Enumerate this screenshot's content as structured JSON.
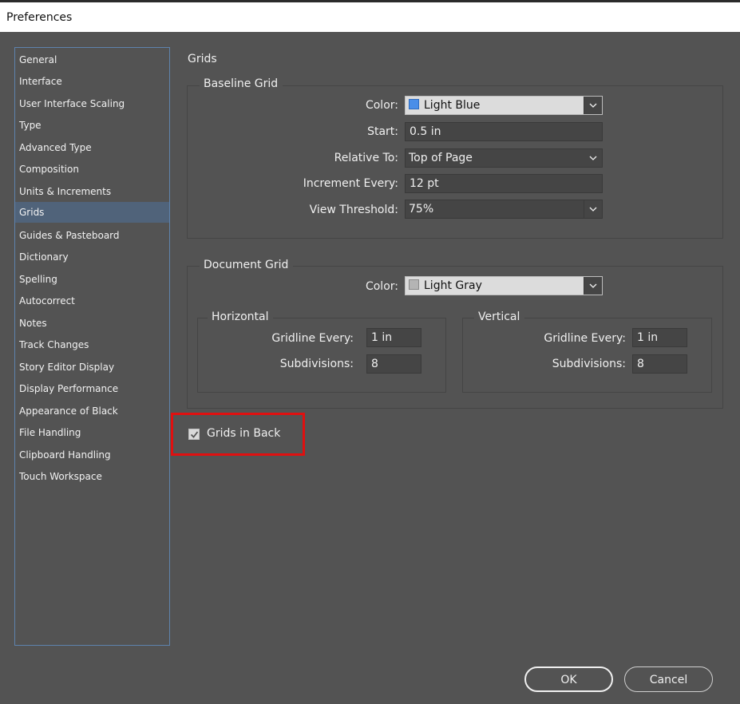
{
  "window": {
    "title": "Preferences"
  },
  "sidebar": {
    "items": [
      {
        "label": "General"
      },
      {
        "label": "Interface"
      },
      {
        "label": "User Interface Scaling"
      },
      {
        "label": "Type"
      },
      {
        "label": "Advanced Type"
      },
      {
        "label": "Composition"
      },
      {
        "label": "Units & Increments"
      },
      {
        "label": "Grids",
        "selected": true
      },
      {
        "label": "Guides & Pasteboard"
      },
      {
        "label": "Dictionary"
      },
      {
        "label": "Spelling"
      },
      {
        "label": "Autocorrect"
      },
      {
        "label": "Notes"
      },
      {
        "label": "Track Changes"
      },
      {
        "label": "Story Editor Display"
      },
      {
        "label": "Display Performance"
      },
      {
        "label": "Appearance of Black"
      },
      {
        "label": "File Handling"
      },
      {
        "label": "Clipboard Handling"
      },
      {
        "label": "Touch Workspace"
      }
    ]
  },
  "panel": {
    "title": "Grids"
  },
  "baseline_grid": {
    "legend": "Baseline Grid",
    "color_label": "Color:",
    "color_value": "Light Blue",
    "color_swatch": "#4a8ee8",
    "start_label": "Start:",
    "start_value": "0.5 in",
    "relative_label": "Relative To:",
    "relative_value": "Top of Page",
    "increment_label": "Increment Every:",
    "increment_value": "12 pt",
    "threshold_label": "View Threshold:",
    "threshold_value": "75%"
  },
  "document_grid": {
    "legend": "Document Grid",
    "color_label": "Color:",
    "color_value": "Light Gray",
    "color_swatch": "#b4b4b4",
    "horizontal": {
      "legend": "Horizontal",
      "gridline_label": "Gridline Every:",
      "gridline_value": "1 in",
      "subdivisions_label": "Subdivisions:",
      "subdivisions_value": "8"
    },
    "vertical": {
      "legend": "Vertical",
      "gridline_label": "Gridline Every:",
      "gridline_value": "1 in",
      "subdivisions_label": "Subdivisions:",
      "subdivisions_value": "8"
    }
  },
  "grids_in_back": {
    "label": "Grids in Back",
    "checked": true
  },
  "buttons": {
    "ok": "OK",
    "cancel": "Cancel"
  },
  "colors": {
    "highlight": "#e01010",
    "selection": "#50637a",
    "background": "#535353"
  }
}
